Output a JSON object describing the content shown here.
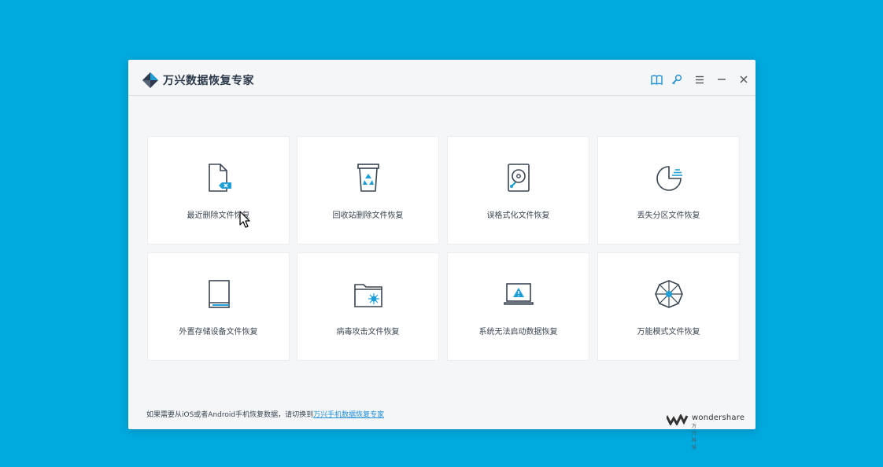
{
  "app": {
    "title": "万兴数据恢复专家"
  },
  "toolbar": {
    "icons": [
      "book-icon",
      "key-icon",
      "menu-icon",
      "minimize-icon",
      "close-icon"
    ]
  },
  "cards": [
    {
      "label": "最近删除文件恢复",
      "icon": "deleted-file-icon"
    },
    {
      "label": "回收站删除文件恢复",
      "icon": "recycle-bin-icon"
    },
    {
      "label": "误格式化文件恢复",
      "icon": "hard-drive-icon"
    },
    {
      "label": "丢失分区文件恢复",
      "icon": "partition-icon"
    },
    {
      "label": "外置存储设备文件恢复",
      "icon": "external-drive-icon"
    },
    {
      "label": "病毒攻击文件恢复",
      "icon": "virus-folder-icon"
    },
    {
      "label": "系统无法启动数据恢复",
      "icon": "laptop-warning-icon"
    },
    {
      "label": "万能模式文件恢复",
      "icon": "all-round-icon"
    }
  ],
  "footer": {
    "text": "如果需要从iOS或者Android手机恢复数据，请切换到",
    "link": "万兴手机数据恢复专家"
  },
  "brand": {
    "name": "wondershare",
    "sub": "万兴科技"
  },
  "colors": {
    "background": "#00a9de",
    "accent": "#1f9fd8",
    "icon_stroke": "#3a4552"
  }
}
